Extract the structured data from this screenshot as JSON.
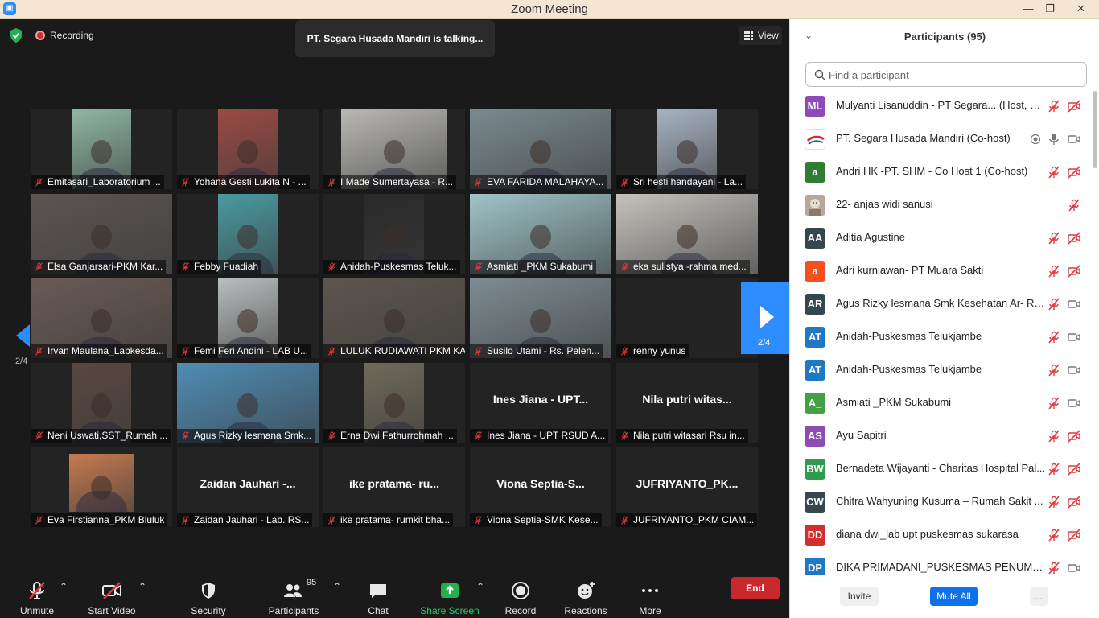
{
  "window": {
    "title": "Zoom Meeting",
    "app_icon": "zoom-icon"
  },
  "meeting": {
    "recording_label": "Recording",
    "talking_text": "PT. Segara Husada Mandiri is talking...",
    "view_label": "View",
    "page_left": "2/4",
    "page_right": "2/4"
  },
  "tiles": [
    {
      "name": "Emitasari_Laboratorium ...",
      "video": true,
      "vw": 74,
      "bg": "#8fb7a4"
    },
    {
      "name": "Yohana Gesti Lukita N - ...",
      "video": true,
      "vw": 74,
      "bg": "#9b4a44"
    },
    {
      "name": "I Made Sumertayasa - R...",
      "video": true,
      "vw": 132,
      "bg": "#b9b8b4"
    },
    {
      "name": "EVA FARIDA MALAHAYA...",
      "video": true,
      "vw": 176,
      "bg": "#7a8a90"
    },
    {
      "name": "Sri hesti handayani - La...",
      "video": true,
      "vw": 74,
      "bg": "#a7b3c2"
    },
    {
      "name": "Elsa Ganjarsari-PKM Kar...",
      "video": true,
      "vw": 176,
      "bg": "#5b5552"
    },
    {
      "name": "Febby Fuadiah",
      "video": true,
      "vw": 74,
      "bg": "#4a9aa2"
    },
    {
      "name": "Anidah-Puskesmas Teluk...",
      "video": true,
      "vw": 74,
      "bg": "#2a2a2a"
    },
    {
      "name": "Asmiati _PKM Sukabumi",
      "video": true,
      "vw": 176,
      "bg": "#9fc4c9"
    },
    {
      "name": "eka sulistya -rahma med...",
      "video": true,
      "vw": 176,
      "bg": "#c5c2bd"
    },
    {
      "name": "Irvan Maulana_Labkesda...",
      "video": true,
      "vw": 176,
      "bg": "#6a5a55"
    },
    {
      "name": "Femi Feri Andini - LAB U...",
      "video": true,
      "vw": 74,
      "bg": "#b9bdbd"
    },
    {
      "name": "LULUK RUDIAWATI PKM KA...",
      "video": true,
      "vw": 176,
      "bg": "#5d564e"
    },
    {
      "name": "Susilo Utami - Rs. Pelen...",
      "video": true,
      "vw": 176,
      "bg": "#7e8c93"
    },
    {
      "name": "renny yunus",
      "video": false
    },
    {
      "name": "Neni Uswati,SST_Rumah ...",
      "video": true,
      "vw": 74,
      "bg": "#5a4740"
    },
    {
      "name": "Agus Rizky lesmana Smk...",
      "video": true,
      "vw": 176,
      "bg": "#4e8db5"
    },
    {
      "name": "Erna Dwi Fathurrohmah ...",
      "video": true,
      "vw": 74,
      "bg": "#6f6a5a"
    },
    {
      "name": "Ines Jiana - UPT RSUD A...",
      "video": false,
      "big": "Ines Jiana - UPT..."
    },
    {
      "name": "Nila putri witasari Rsu in...",
      "video": false,
      "big": "Nila putri witas..."
    },
    {
      "name": "Eva Firstianna_PKM Bluluk",
      "video": true,
      "vw": 80,
      "bg": "#c77b4f",
      "inset": true
    },
    {
      "name": "Zaidan Jauhari - Lab. RS...",
      "video": false,
      "big": "Zaidan Jauhari -..."
    },
    {
      "name": "ike pratama- rumkit bha...",
      "video": false,
      "big": "ike pratama- ru..."
    },
    {
      "name": "Viona Septia-SMK Kese...",
      "video": false,
      "big": "Viona Septia-S..."
    },
    {
      "name": "JUFRIYANTO_PKM CIAM...",
      "video": false,
      "big": "JUFRIYANTO_PK..."
    }
  ],
  "toolbar": {
    "unmute": "Unmute",
    "start_video": "Start Video",
    "security": "Security",
    "participants": "Participants",
    "participants_count": "95",
    "chat": "Chat",
    "share_screen": "Share Screen",
    "record": "Record",
    "reactions": "Reactions",
    "more": "More",
    "end": "End"
  },
  "panel": {
    "title": "Participants (95)",
    "search_placeholder": "Find a participant",
    "invite": "Invite",
    "mute_all": "Mute All",
    "more": "...",
    "participants": [
      {
        "initials": "ML",
        "color": "#8e4bb5",
        "name": "Mulyanti Lisanuddin - PT Segara... (Host, me)",
        "mic": "off",
        "cam": "off"
      },
      {
        "initials": "",
        "color": "#ffffff",
        "logo": true,
        "name": "PT. Segara Husada Mandiri (Co-host)",
        "mic": "on",
        "cam": "on",
        "rec": true
      },
      {
        "initials": "a",
        "color": "#2e7d32",
        "name": "Andri HK -PT. SHM  - Co Host 1 (Co-host)",
        "mic": "off",
        "cam": "off"
      },
      {
        "initials": "",
        "color": "#b7a99a",
        "photo": true,
        "name": "22- anjas widi sanusi",
        "mic": "off",
        "cam": "none"
      },
      {
        "initials": "AA",
        "color": "#37474f",
        "name": "Aditia Agustine",
        "mic": "off",
        "cam": "off"
      },
      {
        "initials": "a",
        "color": "#f4511e",
        "name": "Adri kurniawan- PT Muara Sakti",
        "mic": "off",
        "cam": "off"
      },
      {
        "initials": "AR",
        "color": "#37474f",
        "name": "Agus Rizky lesmana Smk Kesehatan Ar- Rai...",
        "mic": "off",
        "cam": "on"
      },
      {
        "initials": "AT",
        "color": "#1e78c2",
        "name": "Anidah-Puskesmas Telukjambe",
        "mic": "off",
        "cam": "on"
      },
      {
        "initials": "AT",
        "color": "#1e78c2",
        "name": "Anidah-Puskesmas Telukjambe",
        "mic": "off",
        "cam": "on"
      },
      {
        "initials": "A_",
        "color": "#43a047",
        "name": "Asmiati _PKM Sukabumi",
        "mic": "off",
        "cam": "on"
      },
      {
        "initials": "AS",
        "color": "#8e4bb5",
        "name": "Ayu Sapitri",
        "mic": "off",
        "cam": "off"
      },
      {
        "initials": "BW",
        "color": "#2e9b4f",
        "name": "Bernadeta Wijayanti - Charitas Hospital Pal...",
        "mic": "off",
        "cam": "off"
      },
      {
        "initials": "CW",
        "color": "#37474f",
        "name": "Chitra Wahyuning Kusuma – Rumah Sakit ...",
        "mic": "off",
        "cam": "off"
      },
      {
        "initials": "DD",
        "color": "#d32f2f",
        "name": "diana dwi_lab upt puskesmas sukarasa",
        "mic": "off",
        "cam": "off"
      },
      {
        "initials": "DP",
        "color": "#1e78c2",
        "name": "DIKA PRIMADANI_PUSKESMAS PENUMPIN...",
        "mic": "off",
        "cam": "on"
      }
    ]
  }
}
